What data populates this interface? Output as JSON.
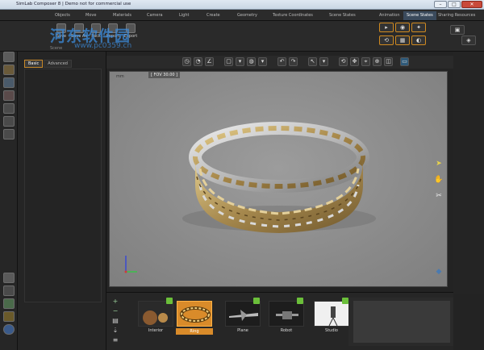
{
  "window": {
    "title": "SimLab Composer 8 | Demo not for commercial use"
  },
  "top_tabs": {
    "left": [
      "Objects",
      "Move",
      "Materials",
      "Camera",
      "Light",
      "Create",
      "Geometry",
      "Texture Coordinates",
      "Scene States"
    ],
    "right": [
      "Animation",
      "Scene States",
      "Sharing Resources"
    ],
    "active_right": "Scene States"
  },
  "ribbon": {
    "buttons": [
      "Save",
      "Save As",
      "Pack",
      "Import",
      "Export"
    ],
    "group_label": "Scene"
  },
  "panel": {
    "tabs": [
      "Basic",
      "Advanced"
    ],
    "active_tab": "Basic"
  },
  "viewport": {
    "label": "mm",
    "fov": "[ FOV 30.00 ]"
  },
  "tray": {
    "environments": [
      {
        "name": "Interior",
        "selected": false
      },
      {
        "name": "Ring",
        "selected": true
      },
      {
        "name": "Plane",
        "selected": false
      },
      {
        "name": "Robot",
        "selected": false
      },
      {
        "name": "Studio",
        "selected": false
      }
    ]
  },
  "watermark": {
    "text": "河东软件园",
    "url": "www.pc0359.cn"
  },
  "colors": {
    "accent": "#d98b2a",
    "ring_gold": "#b69a5a",
    "ring_silver": "#cfcfcf",
    "viewport_bg": "#8f8f8f"
  }
}
